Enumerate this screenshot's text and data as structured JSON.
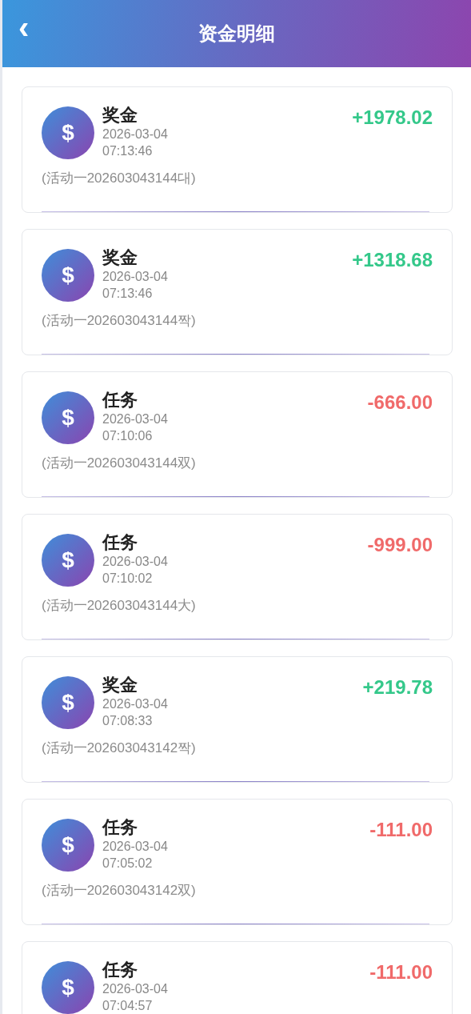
{
  "header": {
    "title": "资金明细",
    "back": "‹"
  },
  "records": [
    {
      "title": "奖金",
      "date": "2026-03-04",
      "time": "07:13:46",
      "amount": "+1978.02",
      "kind": "credit",
      "note": "(活动一202603043144대)",
      "icon": "$"
    },
    {
      "title": "奖金",
      "date": "2026-03-04",
      "time": "07:13:46",
      "amount": "+1318.68",
      "kind": "credit",
      "note": "(活动一202603043144짝)",
      "icon": "$"
    },
    {
      "title": "任务",
      "date": "2026-03-04",
      "time": "07:10:06",
      "amount": "-666.00",
      "kind": "debit",
      "note": "(活动一202603043144双)",
      "icon": "$"
    },
    {
      "title": "任务",
      "date": "2026-03-04",
      "time": "07:10:02",
      "amount": "-999.00",
      "kind": "debit",
      "note": "(活动一202603043144大)",
      "icon": "$"
    },
    {
      "title": "奖金",
      "date": "2026-03-04",
      "time": "07:08:33",
      "amount": "+219.78",
      "kind": "credit",
      "note": "(活动一202603043142짝)",
      "icon": "$"
    },
    {
      "title": "任务",
      "date": "2026-03-04",
      "time": "07:05:02",
      "amount": "-111.00",
      "kind": "debit",
      "note": "(活动一202603043142双)",
      "icon": "$"
    },
    {
      "title": "任务",
      "date": "2026-03-04",
      "time": "07:04:57",
      "amount": "-111.00",
      "kind": "debit",
      "icon": "$"
    }
  ]
}
